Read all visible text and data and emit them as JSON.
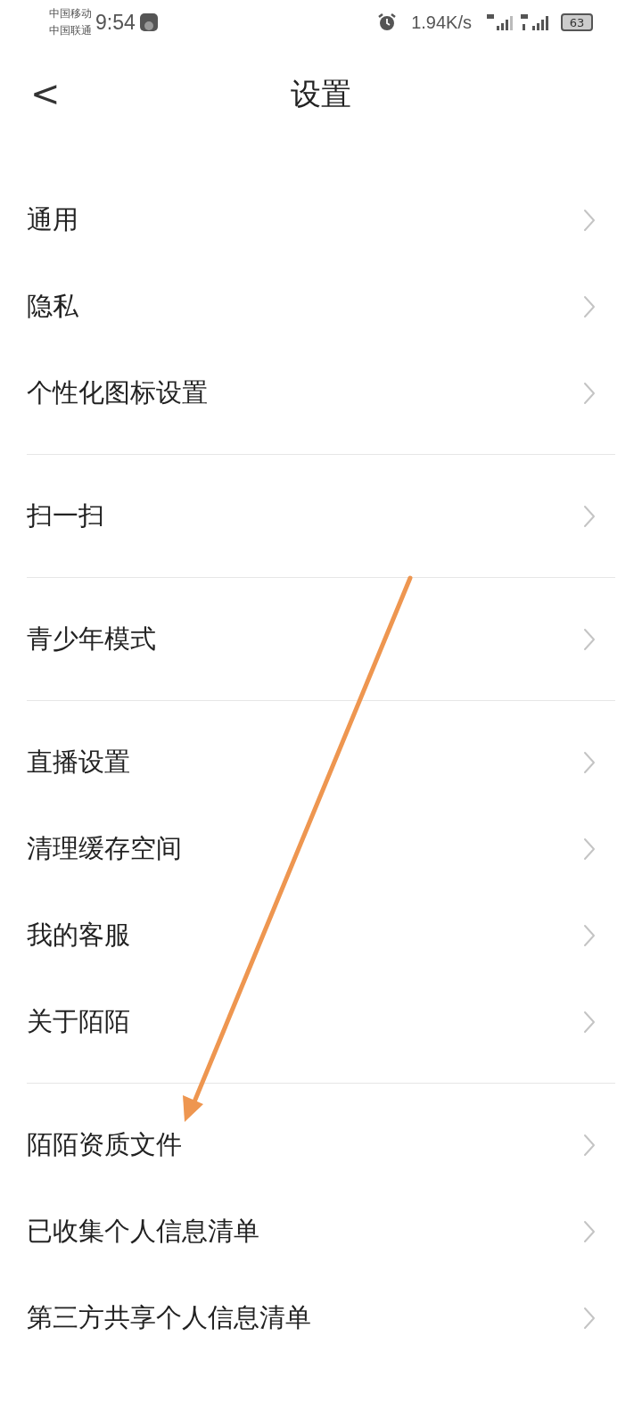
{
  "status_bar": {
    "carriers": [
      "中国移动",
      "中国联通"
    ],
    "time": "9:54",
    "speed": "1.94K/s",
    "battery": "63"
  },
  "header": {
    "back": "<",
    "title": "设置"
  },
  "groups": [
    {
      "items": [
        "通用",
        "隐私",
        "个性化图标设置"
      ]
    },
    {
      "items": [
        "扫一扫"
      ]
    },
    {
      "items": [
        "青少年模式"
      ]
    },
    {
      "items": [
        "直播设置",
        "清理缓存空间",
        "我的客服",
        "关于陌陌"
      ]
    },
    {
      "items": [
        "陌陌资质文件",
        "已收集个人信息清单",
        "第三方共享个人信息清单"
      ]
    }
  ]
}
